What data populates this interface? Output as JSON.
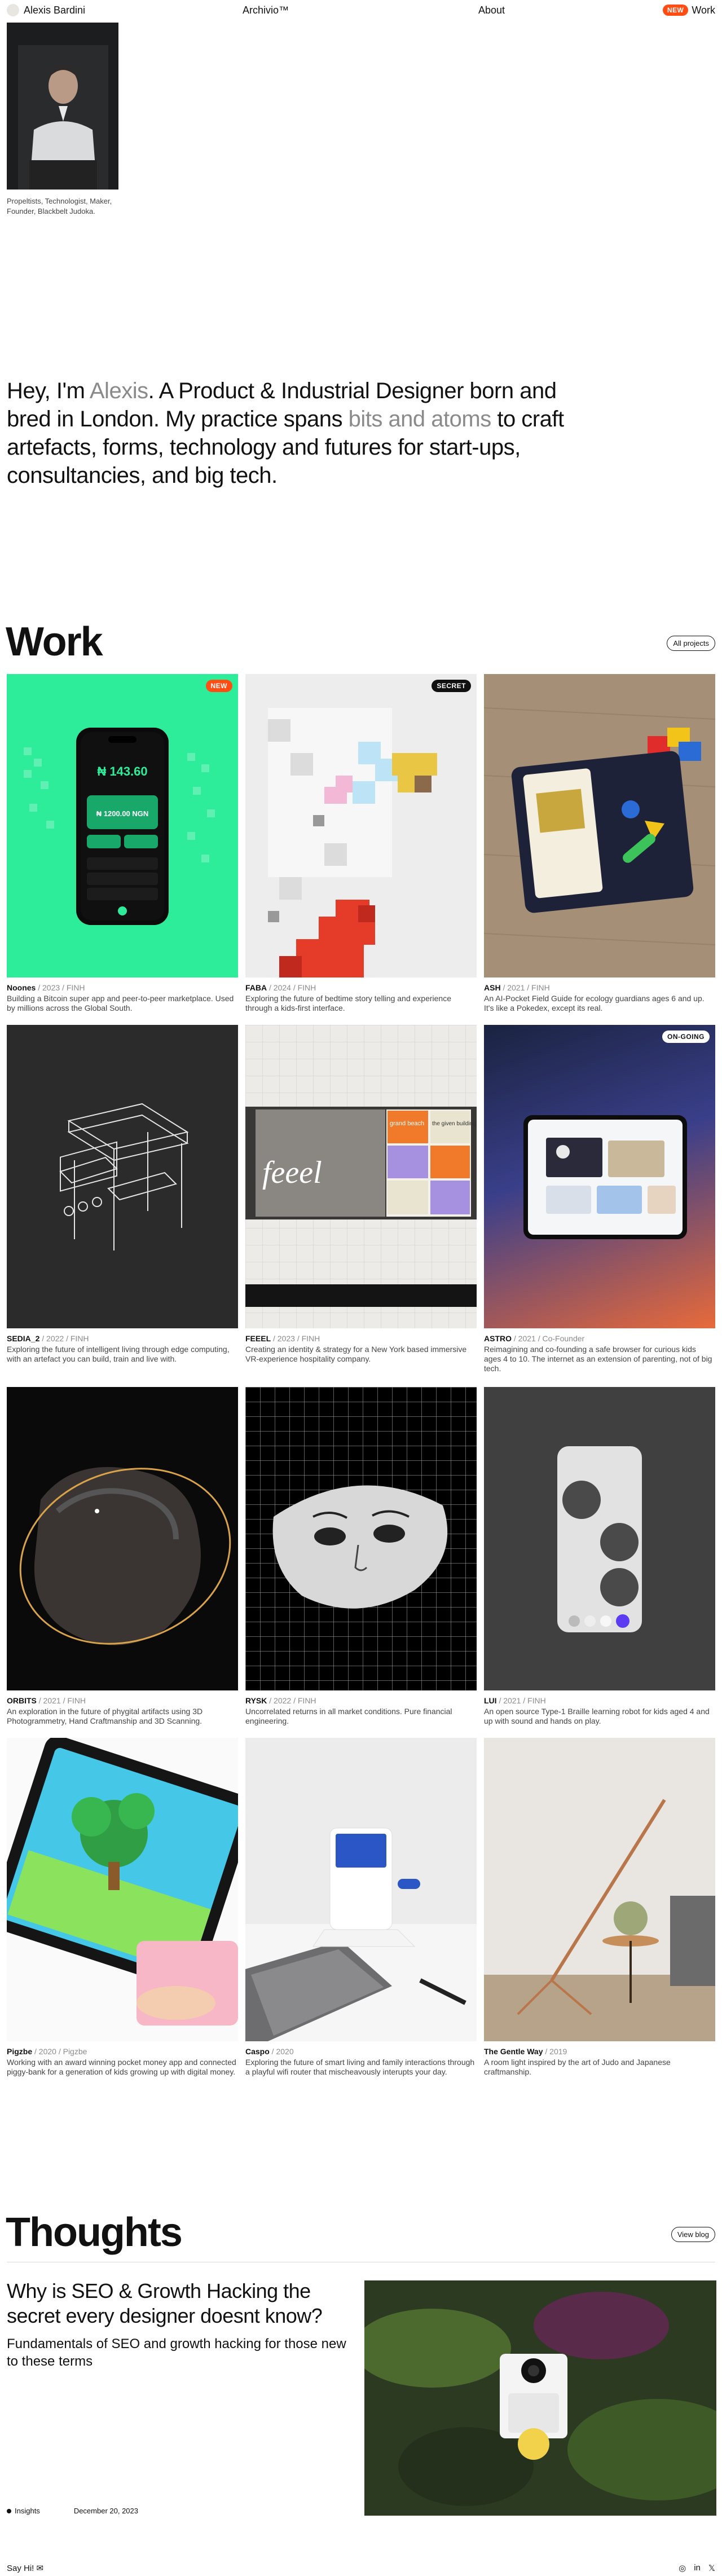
{
  "header": {
    "name": "Alexis Bardini",
    "archive": "Archivio™",
    "about": "About",
    "work_badge": "NEW",
    "work": "Work"
  },
  "portrait": {
    "caption": "Propeltists, Technologist, Maker, Founder, Blackbelt Judoka."
  },
  "hero": {
    "t1": "Hey, I'm ",
    "name": "Alexis",
    "t2": ". A Product & Industrial Designer born and bred in London. My practice spans ",
    "span": "bits and atoms",
    "t3": " to craft artefacts, forms, technology and futures for start-ups, consultancies, and big tech."
  },
  "work": {
    "title": "Work",
    "all_projects": "All projects",
    "projects": [
      {
        "name": "Noones",
        "sub": " / 2023 / FINH",
        "desc": "Building a Bitcoin super app and peer-to-peer marketplace. Used by millions across the Global South.",
        "tag": "NEW",
        "amount": "₦ 143.60",
        "amount2": "₦ 1200.00 NGN"
      },
      {
        "name": "FABA",
        "sub": " / 2024 / FINH",
        "desc": "Exploring the future of bedtime story telling and experience through a kids-first interface.",
        "tag": "SECRET"
      },
      {
        "name": "ASH",
        "sub": " / 2021 / FINH",
        "desc": "An AI-Pocket Field Guide for ecology guardians ages 6 and up. It's like a Pokedex, except its real.",
        "tag": ""
      },
      {
        "name": "SEDIA_2",
        "sub": " / 2022 / FINH",
        "desc": "Exploring the future of intelligent living through edge computing, with an artefact you can build, train and live with.",
        "tag": ""
      },
      {
        "name": "FEEEL",
        "sub": " / 2023 / FINH",
        "desc": "Creating an identity & strategy for a New York based immersive VR-experience hospitality company.",
        "tag": "",
        "logo": "feeel",
        "poster": "grand beach",
        "poster2": "the given building"
      },
      {
        "name": "ASTRO",
        "sub": " / 2021 / Co-Founder",
        "desc": "Reimagining and co-founding a safe browser for curious kids ages 4 to 10. The internet as an extension of parenting, not of big tech.",
        "tag": "ON-GOING"
      },
      {
        "name": "ORBITS",
        "sub": " / 2021 / FINH",
        "desc": "An exploration in the future of phygital artifacts using 3D Photogrammetry, Hand Craftmanship and 3D Scanning.",
        "tag": ""
      },
      {
        "name": "RYSK",
        "sub": " / 2022 / FINH",
        "desc": "Uncorrelated returns in all market conditions. Pure financial engineering.",
        "tag": ""
      },
      {
        "name": "LUI",
        "sub": " / 2021 / FINH",
        "desc": "An open source Type-1 Braille learning robot for kids aged 4 and up with sound and hands on play.",
        "tag": ""
      },
      {
        "name": "Pigzbe",
        "sub": " / 2020 / Pigzbe",
        "desc": "Working with an award winning pocket money app and connected piggy-bank for a generation of kids growing up with digital money.",
        "tag": ""
      },
      {
        "name": "Caspo",
        "sub": " / 2020",
        "desc": "Exploring the future of smart living and family interactions through a playful wifi router that mischeavously interupts your day.",
        "tag": ""
      },
      {
        "name": "The Gentle Way",
        "sub": " / 2019",
        "desc": "A room light inspired by the art of Judo and Japanese craftmanship.",
        "tag": ""
      }
    ]
  },
  "thoughts": {
    "title": "Thoughts",
    "view_blog": "View blog",
    "post_title": "Why is SEO & Growth Hacking the secret every designer doesnt know?",
    "post_sub": "Fundamentals of SEO and growth hacking for those new to these terms",
    "category": "Insights",
    "date": "December 20, 2023"
  },
  "footer": {
    "say_hi": "Say Hi! ✉",
    "social": [
      "◎",
      "in",
      "𝕏"
    ]
  }
}
